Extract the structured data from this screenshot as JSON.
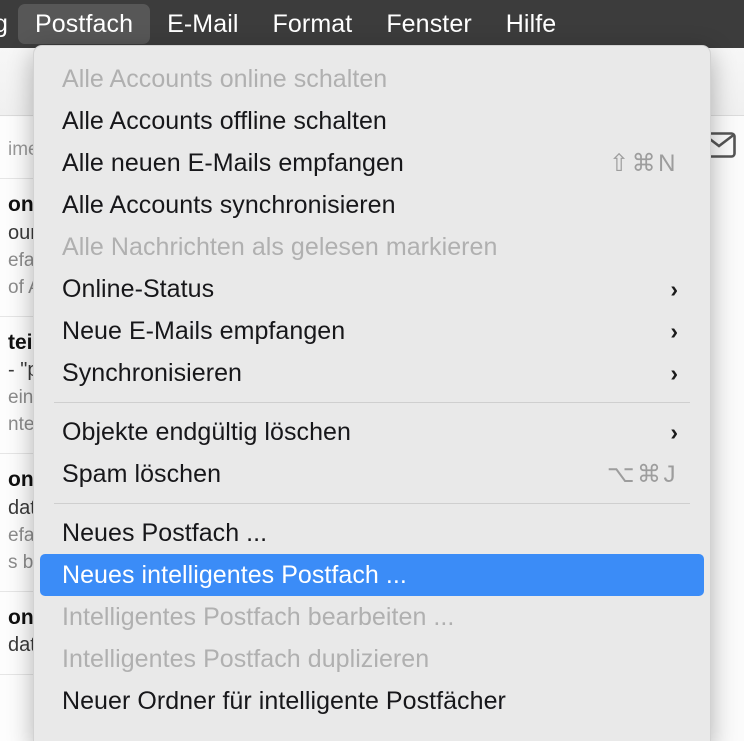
{
  "menubar": {
    "items": [
      {
        "label": "g",
        "active": false,
        "clipped": true
      },
      {
        "label": "Postfach",
        "active": true,
        "clipped": false
      },
      {
        "label": "E-Mail",
        "active": false,
        "clipped": false
      },
      {
        "label": "Format",
        "active": false,
        "clipped": false
      },
      {
        "label": "Fenster",
        "active": false,
        "clipped": false
      },
      {
        "label": "Hilfe",
        "active": false,
        "clipped": false
      }
    ]
  },
  "background": {
    "envelope_icon": "envelope-icon",
    "search_text": "ime",
    "messages": [
      {
        "title": "on",
        "sub": "our",
        "prev1": "efar",
        "prev2": "of A"
      },
      {
        "title": "tei",
        "sub": "- \"p",
        "prev1": "ein",
        "prev2": "nte"
      },
      {
        "title": "on",
        "sub": "dat",
        "prev1": "efar",
        "prev2": "s by"
      },
      {
        "title": "on",
        "sub": "dat",
        "prev1": "",
        "prev2": ""
      }
    ]
  },
  "menu": {
    "title": "Postfach",
    "accent_color": "#3b8cf7",
    "background_color": "#e9e9e9",
    "entries": [
      {
        "type": "item",
        "label": "Alle Accounts online schalten",
        "disabled": true,
        "shortcut": "",
        "submenu": false
      },
      {
        "type": "item",
        "label": "Alle Accounts offline schalten",
        "disabled": false,
        "shortcut": "",
        "submenu": false
      },
      {
        "type": "item",
        "label": "Alle neuen E-Mails empfangen",
        "disabled": false,
        "shortcut": "⇧⌘N",
        "submenu": false
      },
      {
        "type": "item",
        "label": "Alle Accounts synchronisieren",
        "disabled": false,
        "shortcut": "",
        "submenu": false
      },
      {
        "type": "item",
        "label": "Alle Nachrichten als gelesen markieren",
        "disabled": true,
        "shortcut": "",
        "submenu": false
      },
      {
        "type": "item",
        "label": "Online-Status",
        "disabled": false,
        "shortcut": "",
        "submenu": true
      },
      {
        "type": "item",
        "label": "Neue E-Mails empfangen",
        "disabled": false,
        "shortcut": "",
        "submenu": true
      },
      {
        "type": "item",
        "label": "Synchronisieren",
        "disabled": false,
        "shortcut": "",
        "submenu": true
      },
      {
        "type": "separator"
      },
      {
        "type": "item",
        "label": "Objekte endgültig löschen",
        "disabled": false,
        "shortcut": "",
        "submenu": true
      },
      {
        "type": "item",
        "label": "Spam löschen",
        "disabled": false,
        "shortcut": "⌥⌘J",
        "submenu": false
      },
      {
        "type": "separator"
      },
      {
        "type": "item",
        "label": "Neues Postfach ...",
        "disabled": false,
        "shortcut": "",
        "submenu": false
      },
      {
        "type": "item",
        "label": "Neues intelligentes Postfach ...",
        "disabled": false,
        "selected": true,
        "shortcut": "",
        "submenu": false
      },
      {
        "type": "item",
        "label": "Intelligentes Postfach bearbeiten ...",
        "disabled": true,
        "shortcut": "",
        "submenu": false
      },
      {
        "type": "item",
        "label": "Intelligentes Postfach duplizieren",
        "disabled": true,
        "shortcut": "",
        "submenu": false
      },
      {
        "type": "item",
        "label": "Neuer Ordner für intelligente Postfächer",
        "disabled": false,
        "shortcut": "",
        "submenu": false
      }
    ]
  }
}
